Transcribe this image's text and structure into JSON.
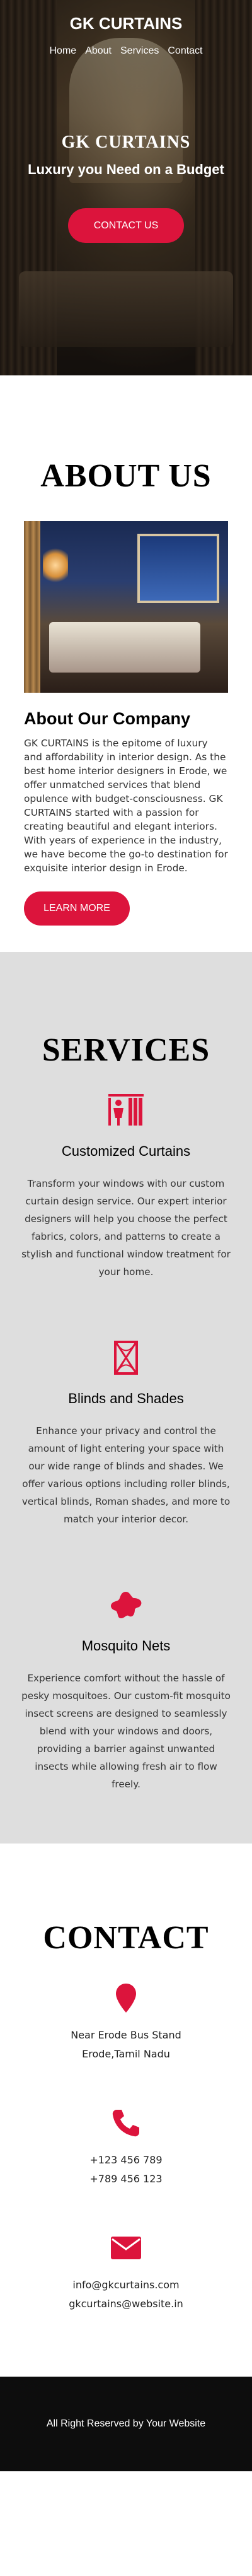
{
  "brand": {
    "title": "GK CURTAINS",
    "accent": "#dc143c"
  },
  "nav": {
    "items": [
      "Home",
      "About",
      "Services",
      "Contact"
    ]
  },
  "hero": {
    "heading": "GK CURTAINS",
    "subheading": "Luxury you Need on a Budget",
    "button": "CONTACT US"
  },
  "about": {
    "heading": "ABOUT US",
    "subheading": "About Our Company",
    "paragraph": "GK CURTAINS is the epitome of luxury and affordability in interior design. As the best home interior designers in Erode, we offer unmatched services that blend opulence with budget-consciousness. GK CURTAINS started with a passion for creating beautiful and elegant interiors. With years of experience in the industry, we have become the go-to destination for exquisite interior design in Erode.",
    "button": "LEARN MORE"
  },
  "services": {
    "heading": "SERVICES",
    "items": [
      {
        "icon": "curtain-icon",
        "title": "Customized Curtains",
        "text": "Transform your windows with our custom curtain design service. Our expert interior designers will help you choose the perfect fabrics, colors, and patterns to create a stylish and functional window treatment for your home."
      },
      {
        "icon": "blinds-icon",
        "title": "Blinds and Shades",
        "text": "Enhance your privacy and control the amount of light entering your space with our wide range of blinds and shades. We offer various options including roller blinds, vertical blinds, Roman shades, and more to match your interior decor."
      },
      {
        "icon": "mosquito-icon",
        "title": "Mosquito Nets",
        "text": "Experience comfort without the hassle of pesky mosquitoes. Our custom-fit mosquito insect screens are designed to seamlessly blend with your windows and doors, providing a barrier against unwanted insects while allowing fresh air to flow freely."
      }
    ]
  },
  "contact": {
    "heading": "CONTACT",
    "address": [
      "Near Erode Bus Stand",
      "Erode,Tamil Nadu"
    ],
    "phones": [
      "+123 456 789",
      "+789 456 123"
    ],
    "emails": [
      "info@gkcurtains.com",
      "gkcurtains@website.in"
    ]
  },
  "footer": {
    "text": "All Right Reserved by Your Website"
  }
}
